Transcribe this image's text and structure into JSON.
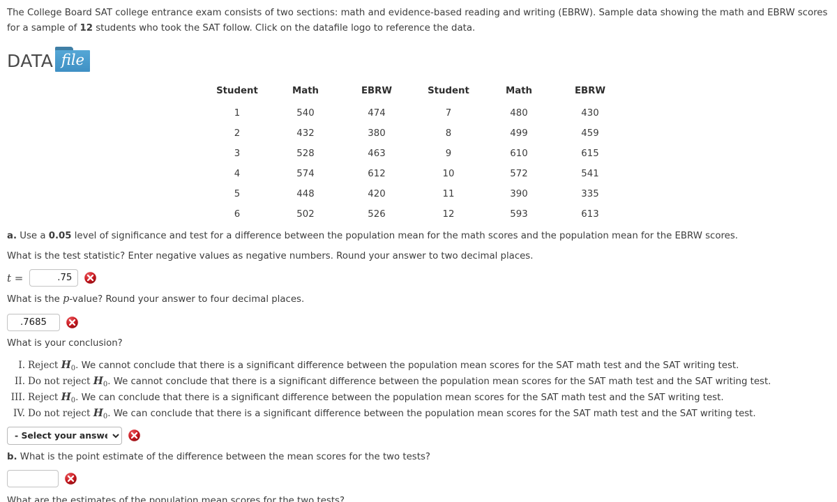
{
  "intro": {
    "part1": "The College Board SAT college entrance exam consists of two sections: math and evidence-based reading and writing (EBRW). Sample data showing the math and EBRW scores for a sample of ",
    "sample_size": "12",
    "part2": " students who took the SAT follow. Click on the datafile logo to reference the data."
  },
  "datafile": {
    "word": "DATA",
    "folder_label": "file"
  },
  "table": {
    "headers": [
      "Student",
      "Math",
      "EBRW",
      "Student",
      "Math",
      "EBRW"
    ],
    "rows": [
      [
        "1",
        "540",
        "474",
        "7",
        "480",
        "430"
      ],
      [
        "2",
        "432",
        "380",
        "8",
        "499",
        "459"
      ],
      [
        "3",
        "528",
        "463",
        "9",
        "610",
        "615"
      ],
      [
        "4",
        "574",
        "612",
        "10",
        "572",
        "541"
      ],
      [
        "5",
        "448",
        "420",
        "11",
        "390",
        "335"
      ],
      [
        "6",
        "502",
        "526",
        "12",
        "593",
        "613"
      ]
    ]
  },
  "part_a": {
    "label": "a.",
    "prompt_pre": " Use a ",
    "alpha": "0.05",
    "prompt_post": " level of significance and test for a difference between the population mean for the math scores and the population mean for the EBRW scores.",
    "test_statistic_question": "What is the test statistic? Enter negative values as negative numbers. Round your answer to two decimal places.",
    "t_label": "t =",
    "t_value": ".75",
    "pvalue_question_pre": "What is the ",
    "pvalue_var": "p",
    "pvalue_question_post": "-value? Round your answer to four decimal places.",
    "p_value": ".7685",
    "conclusion_question": "What is your conclusion?",
    "options": [
      {
        "numeral": "I.",
        "pre": "Reject ",
        "hnull": "H",
        "sub": "0",
        "post": ". We cannot conclude that there is a significant difference between the population mean scores for the SAT math test and the SAT writing test."
      },
      {
        "numeral": "II.",
        "pre": "Do not reject ",
        "hnull": "H",
        "sub": "0",
        "post": ". We cannot conclude that there is a significant difference between the population mean scores for the SAT math test and the SAT writing test."
      },
      {
        "numeral": "III.",
        "pre": "Reject ",
        "hnull": "H",
        "sub": "0",
        "post": ". We can conclude that there is a significant difference between the population mean scores for the SAT math test and the SAT writing test."
      },
      {
        "numeral": "IV.",
        "pre": "Do not reject ",
        "hnull": "H",
        "sub": "0",
        "post": ". We can conclude that there is a significant difference between the population mean scores for the SAT math test and the SAT writing test."
      }
    ],
    "select_value": "- Select your answer -",
    "select_options": [
      "- Select your answer -",
      "I",
      "II",
      "III",
      "IV"
    ]
  },
  "part_b": {
    "label": "b.",
    "prompt": " What is the point estimate of the difference between the mean scores for the two tests?",
    "answer_value": ""
  },
  "clipped_line": {
    "text": "What are the estimates of the population mean scores for the two tests?"
  },
  "icons": {
    "incorrect": "red-x-icon",
    "dropdown": "chevron-down-icon"
  },
  "colors": {
    "text": "#3c3c3c",
    "error_red": "#c0161c",
    "folder_blue": "#4b9fd0",
    "input_border": "#c4c4c4"
  }
}
